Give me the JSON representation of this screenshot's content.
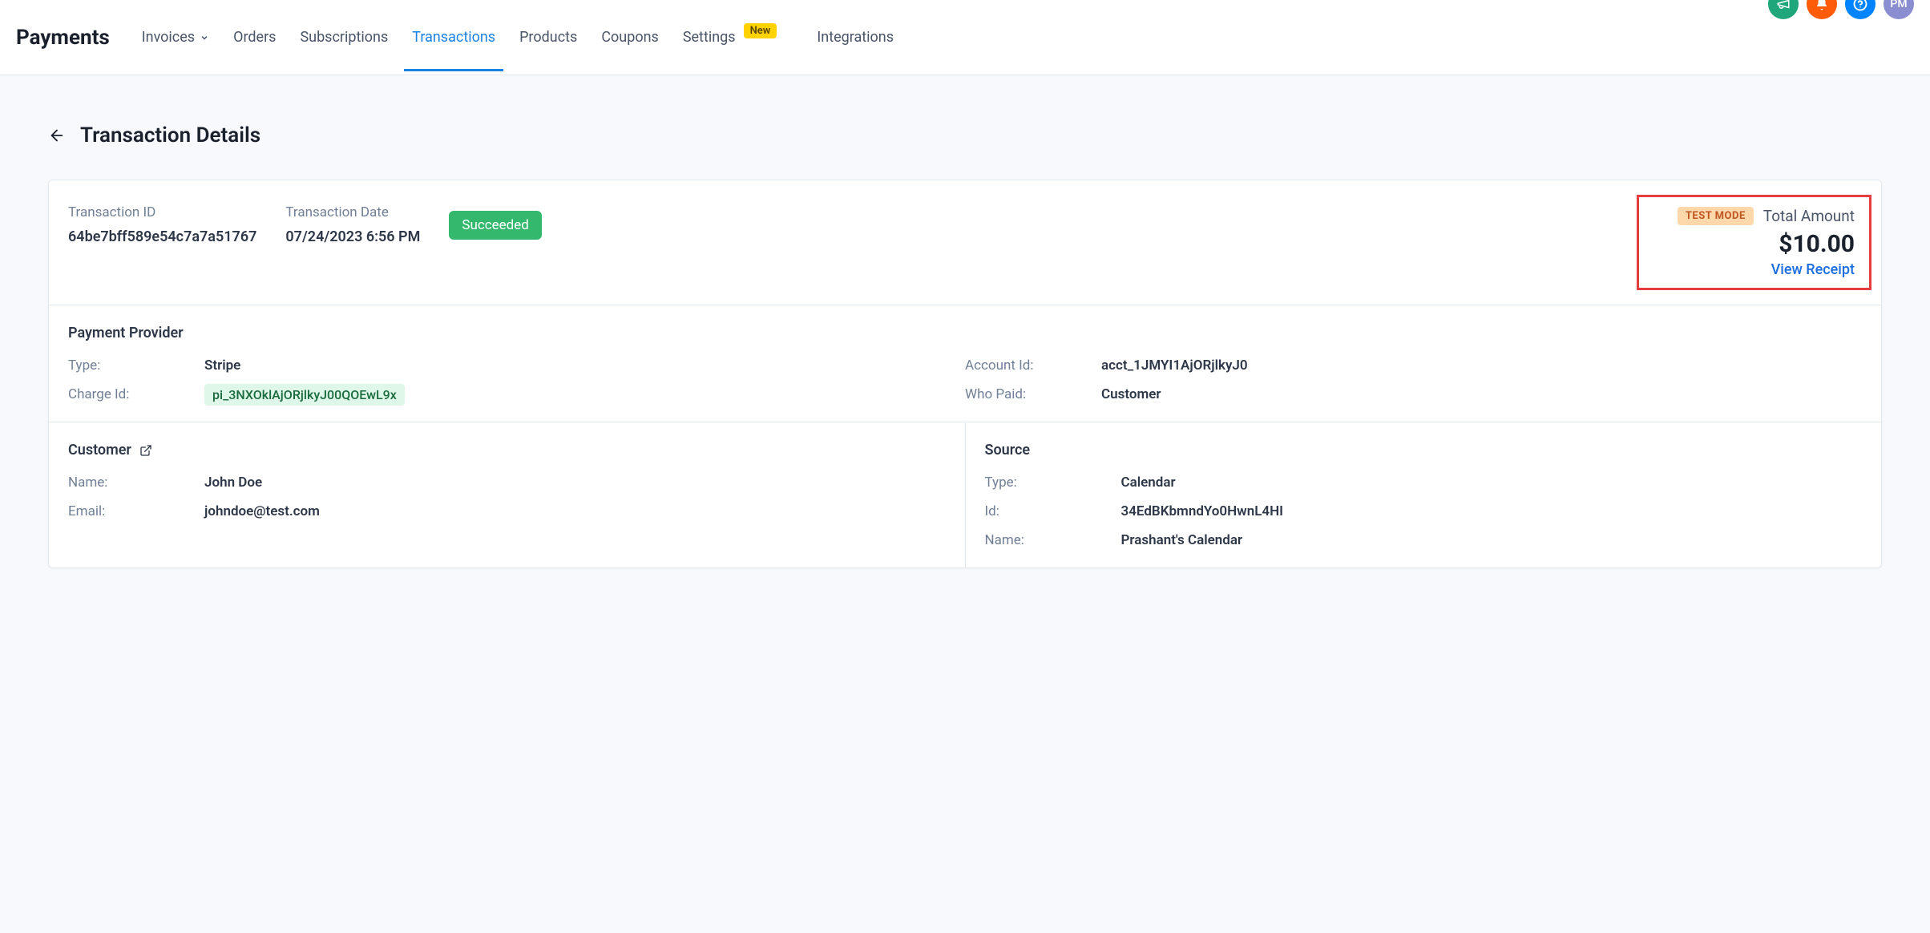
{
  "topbar": {
    "avatar_initials": "PM"
  },
  "header": {
    "title": "Payments",
    "nav": {
      "invoices": "Invoices",
      "orders": "Orders",
      "subscriptions": "Subscriptions",
      "transactions": "Transactions",
      "products": "Products",
      "coupons": "Coupons",
      "settings": "Settings",
      "settings_badge": "New",
      "integrations": "Integrations"
    }
  },
  "page": {
    "title": "Transaction Details"
  },
  "transaction": {
    "id_label": "Transaction ID",
    "id_value": "64be7bff589e54c7a7a51767",
    "date_label": "Transaction Date",
    "date_value": "07/24/2023 6:56 PM",
    "status": "Succeeded",
    "test_mode": "TEST MODE",
    "total_label": "Total Amount",
    "total_value": "$10.00",
    "view_receipt": "View Receipt"
  },
  "provider": {
    "section_title": "Payment Provider",
    "type_label": "Type:",
    "type_value": "Stripe",
    "charge_id_label": "Charge Id:",
    "charge_id_value": "pi_3NXOklAjORjlkyJ00QOEwL9x",
    "account_id_label": "Account Id:",
    "account_id_value": "acct_1JMYI1AjORjlkyJ0",
    "who_paid_label": "Who Paid:",
    "who_paid_value": "Customer"
  },
  "customer": {
    "section_title": "Customer",
    "name_label": "Name:",
    "name_value": "John Doe",
    "email_label": "Email:",
    "email_value": "johndoe@test.com"
  },
  "source": {
    "section_title": "Source",
    "type_label": "Type:",
    "type_value": "Calendar",
    "id_label": "Id:",
    "id_value": "34EdBKbmndYo0HwnL4HI",
    "name_label": "Name:",
    "name_value": "Prashant's Calendar"
  }
}
